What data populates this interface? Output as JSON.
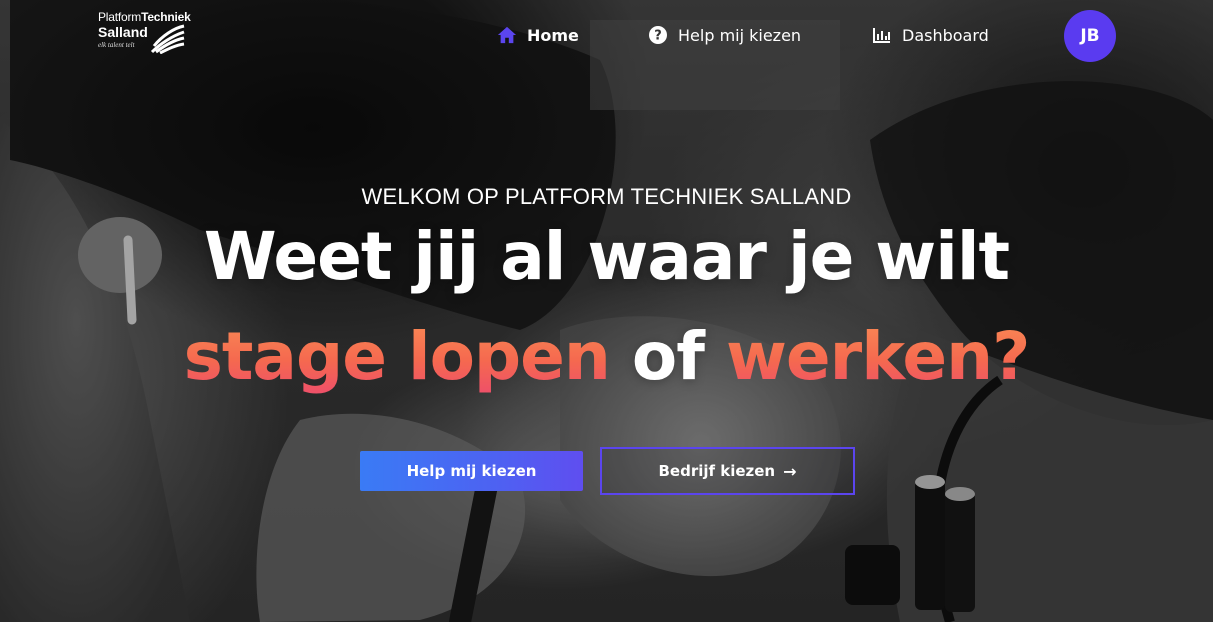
{
  "logo": {
    "line1_a": "Platform",
    "line1_b": "Techniek",
    "line2": "Salland",
    "tagline": "elk talent telt"
  },
  "nav": {
    "home": "Home",
    "help": "Help mij kiezen",
    "dashboard": "Dashboard",
    "avatar_initials": "JB"
  },
  "hero": {
    "eyebrow": "WELKOM OP PLATFORM TECHNIEK SALLAND",
    "line1": "Weet jij al waar je wilt",
    "line2_part1": "stage lopen",
    "line2_part2": " of ",
    "line2_part3": "werken?"
  },
  "buttons": {
    "primary": "Help mij kiezen",
    "secondary": "Bedrijf kiezen",
    "secondary_arrow": "→"
  },
  "colors": {
    "accent": "#5a3bf0",
    "home_icon": "#5b45ee",
    "headline_gradient_start": "#f98b55",
    "headline_gradient_end": "#ee4f6a"
  }
}
